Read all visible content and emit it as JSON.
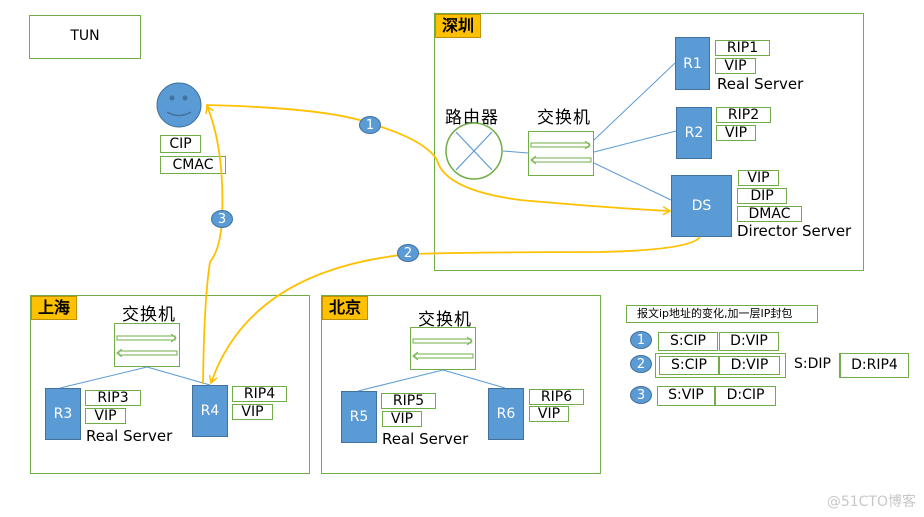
{
  "title": "TUN",
  "colors": {
    "region_border": "#70ad47",
    "region_tag": "#ffc000",
    "server_fill": "#5b9bd5",
    "flow_line": "#ffc000",
    "link_line": "#5b9bd5"
  },
  "client": {
    "icon": "smiley-face-icon",
    "tags": [
      "CIP",
      "CMAC"
    ]
  },
  "regions": {
    "shenzhen": {
      "name": "深圳",
      "router_label": "路由器",
      "switch_label": "交换机",
      "servers": [
        {
          "id": "R1",
          "tags": [
            "RIP1",
            "VIP"
          ],
          "caption": "Real Server"
        },
        {
          "id": "R2",
          "tags": [
            "RIP2",
            "VIP"
          ],
          "caption": ""
        },
        {
          "id": "DS",
          "tags": [
            "VIP",
            "DIP",
            "DMAC"
          ],
          "caption": "Director Server"
        }
      ]
    },
    "shanghai": {
      "name": "上海",
      "switch_label": "交换机",
      "servers": [
        {
          "id": "R3",
          "tags": [
            "RIP3",
            "VIP"
          ],
          "caption": "Real Server"
        },
        {
          "id": "R4",
          "tags": [
            "RIP4",
            "VIP"
          ],
          "caption": ""
        }
      ]
    },
    "beijing": {
      "name": "北京",
      "switch_label": "交换机",
      "servers": [
        {
          "id": "R5",
          "tags": [
            "RIP5",
            "VIP"
          ],
          "caption": "Real Server"
        },
        {
          "id": "R6",
          "tags": [
            "RIP6",
            "VIP"
          ],
          "caption": ""
        }
      ]
    }
  },
  "flow_badges": [
    "1",
    "2",
    "3"
  ],
  "legend": {
    "title": "报文ip地址的变化,加一层IP封包",
    "rows": [
      {
        "step": "1",
        "segments": [
          "S:CIP",
          "D:VIP"
        ]
      },
      {
        "step": "2",
        "segments": [
          "S:CIP",
          "D:VIP",
          "S:DIP",
          "D:RIP4"
        ]
      },
      {
        "step": "3",
        "segments": [
          "S:VIP",
          "D:CIP"
        ]
      }
    ]
  },
  "watermark": "@51CTO博客"
}
